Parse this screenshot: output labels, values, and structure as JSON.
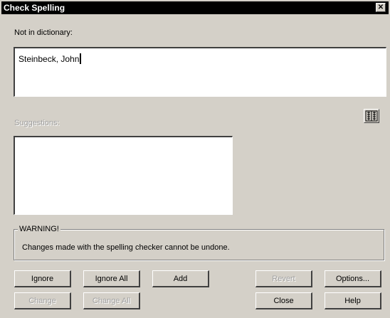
{
  "window": {
    "title": "Check Spelling",
    "close_glyph": "✕"
  },
  "not_in_dictionary": {
    "label": "Not in dictionary:",
    "value": "Steinbeck, John"
  },
  "suggestions": {
    "label": "Suggestions:",
    "items": []
  },
  "dictionary_button": {
    "icon": "dictionary-icon"
  },
  "warning": {
    "title": "WARNING!",
    "text": "Changes made with the spelling checker cannot be undone."
  },
  "buttons": {
    "ignore": "Ignore",
    "ignore_all": "Ignore All",
    "add": "Add",
    "revert": "Revert",
    "options": "Options...",
    "change": "Change",
    "change_all": "Change All",
    "close": "Close",
    "help": "Help"
  }
}
